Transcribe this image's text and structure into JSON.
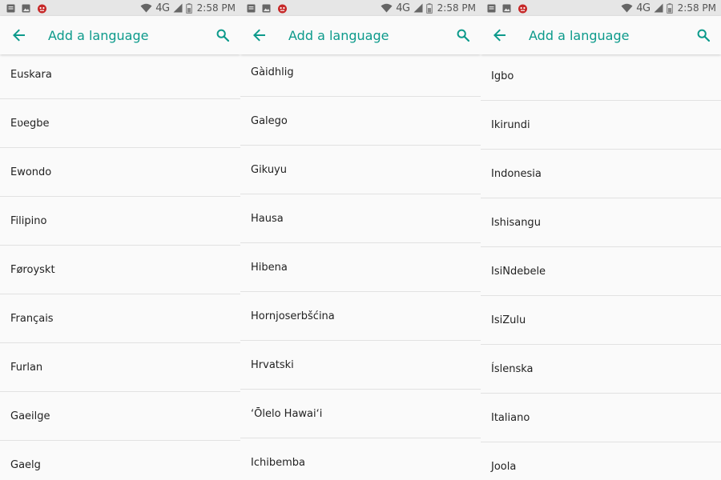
{
  "status_bar": {
    "time": "2:58 PM",
    "network": "4G"
  },
  "app_bar": {
    "title": "Add a language"
  },
  "screens": [
    {
      "items": [
        "Euskara",
        "Eʋegbe",
        "Ewondo",
        "Filipino",
        "Føroyskt",
        "Français",
        "Furlan",
        "Gaeilge",
        "Gaelg"
      ]
    },
    {
      "items": [
        "Gàidhlig",
        "Galego",
        "Gikuyu",
        "Hausa",
        "Hibena",
        "Hornjoserbšćina",
        "Hrvatski",
        "ʻŌlelo Hawaiʻi",
        "Ichibemba"
      ]
    },
    {
      "items": [
        "Igbo",
        "Ikirundi",
        "Indonesia",
        "Ishisangu",
        "IsiNdebele",
        "IsiZulu",
        "Íslenska",
        "Italiano",
        "Joola"
      ]
    }
  ],
  "colors": {
    "accent": "#0c9a8b",
    "status_bg": "#e6e6e6",
    "background": "#fafafa",
    "divider": "#e2e2e2"
  },
  "icons": {
    "back": "arrow-left-icon",
    "search": "search-icon",
    "notif1": "notification-icon",
    "notif2": "image-icon",
    "notif3": "app-icon",
    "wifi": "wifi-icon",
    "signal": "signal-icon",
    "battery": "battery-icon"
  }
}
